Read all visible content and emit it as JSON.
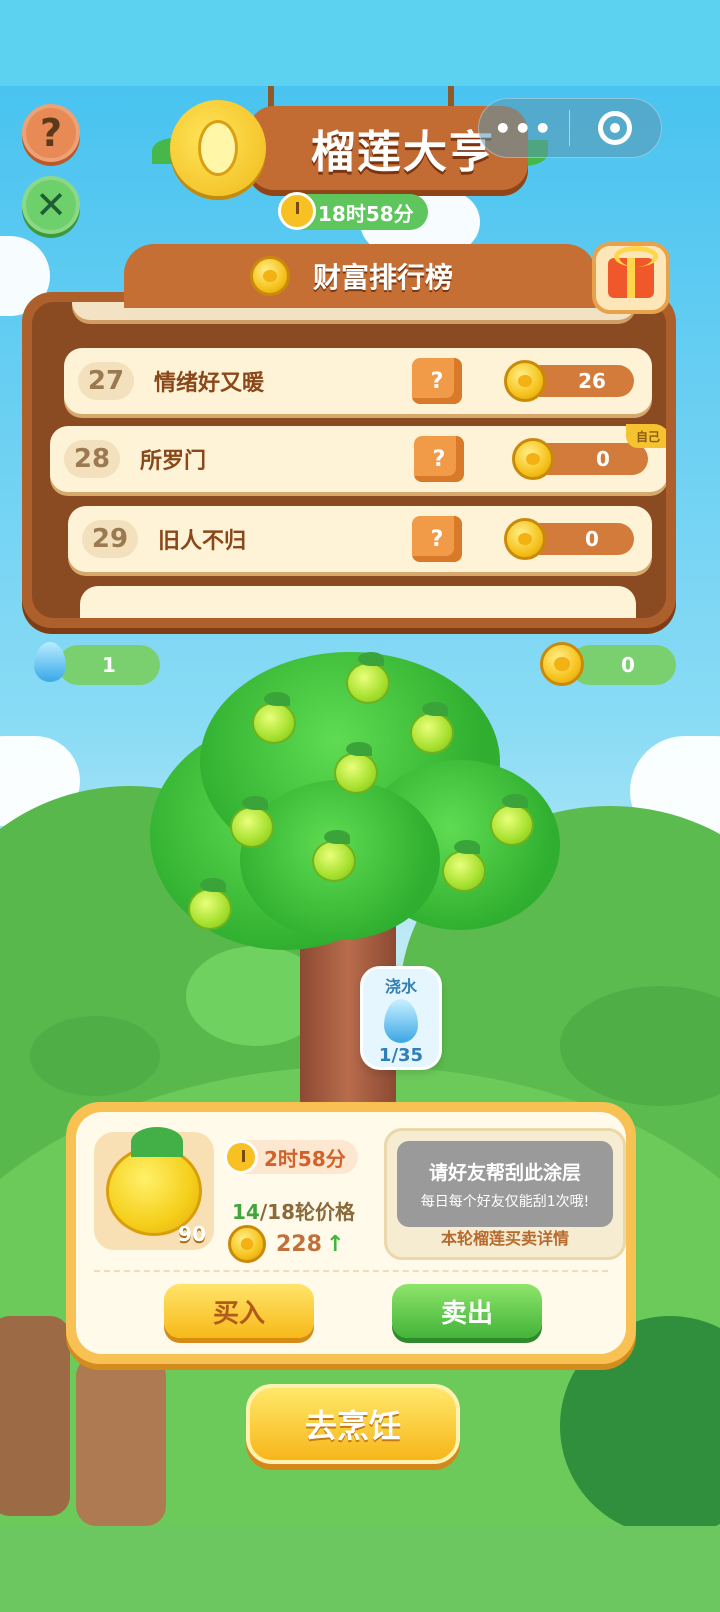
{
  "header": {
    "title": "榴莲大亨",
    "round_timer": "18时58分",
    "capsule_more": "•••"
  },
  "leaderboard": {
    "title": "财富排行榜",
    "rows": [
      {
        "rank": "27",
        "name": "情绪好又暖",
        "score": "26"
      },
      {
        "rank": "28",
        "name": "所罗门",
        "score": "0",
        "self_tag": "自己"
      },
      {
        "rank": "29",
        "name": "旧人不归",
        "score": "0"
      }
    ],
    "mystery_glyph": "?"
  },
  "resources": {
    "water": "1",
    "coins": "0"
  },
  "watering": {
    "label": "浇水",
    "progress": "1/35"
  },
  "trade": {
    "fruit_count": "90",
    "timer": "2时58分",
    "rounds_current": "14",
    "rounds_rest": "/18轮价格",
    "price": "228",
    "price_trend": "↑",
    "scratch_title": "请好友帮刮此涂层",
    "scratch_note": "每日每个好友仅能刮1次哦!",
    "details_link": "本轮榴莲买卖详情",
    "buy_label": "买入",
    "sell_label": "卖出"
  },
  "cook_label": "去烹饪",
  "colors": {
    "wood": "#c26b33",
    "board": "#ad5f2c",
    "green_pill": "#7ad06f",
    "gold": "#f7b919"
  }
}
